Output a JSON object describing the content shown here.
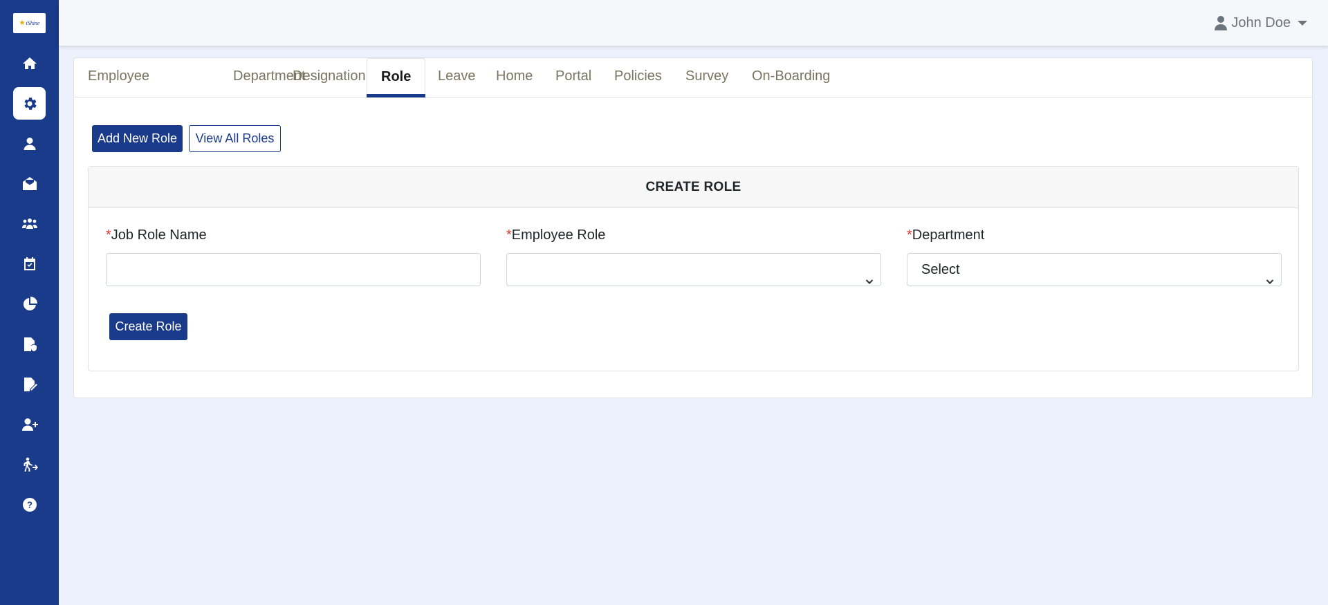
{
  "sidebar": {
    "logo_text": "iShine",
    "items": [
      {
        "name": "home-icon",
        "active": false
      },
      {
        "name": "gear-icon",
        "active": true
      },
      {
        "name": "user-icon",
        "active": false
      },
      {
        "name": "mail-open-icon",
        "active": false
      },
      {
        "name": "people-group-icon",
        "active": false
      },
      {
        "name": "calendar-check-icon",
        "active": false
      },
      {
        "name": "pie-chart-icon",
        "active": false
      },
      {
        "name": "file-shield-icon",
        "active": false
      },
      {
        "name": "file-edit-icon",
        "active": false
      },
      {
        "name": "user-plus-icon",
        "active": false
      },
      {
        "name": "person-exit-icon",
        "active": false
      },
      {
        "name": "help-circle-icon",
        "active": false
      }
    ]
  },
  "header": {
    "user_name": "John Doe"
  },
  "tabs": [
    {
      "label": "Employee"
    },
    {
      "label": "Department"
    },
    {
      "label": "Designation"
    },
    {
      "label": "Role"
    },
    {
      "label": "Leave"
    },
    {
      "label": "Home"
    },
    {
      "label": "Portal"
    },
    {
      "label": "Policies"
    },
    {
      "label": "Survey"
    },
    {
      "label": "On-Boarding"
    }
  ],
  "active_tab": "Role",
  "actions": {
    "add_new_label": "Add New Role",
    "view_all_label": "View All Roles"
  },
  "form": {
    "title": "CREATE ROLE",
    "required_mark": "*",
    "job_role_name_label": "Job Role Name",
    "job_role_name_value": "",
    "employee_role_label": "Employee Role",
    "employee_role_value": "",
    "department_label": "Department",
    "department_value": "Select",
    "submit_label": "Create Role"
  },
  "colors": {
    "primary": "#1a3a8a",
    "background": "#edf1fb",
    "required": "#d9342b",
    "tab_text": "#7a7560"
  }
}
